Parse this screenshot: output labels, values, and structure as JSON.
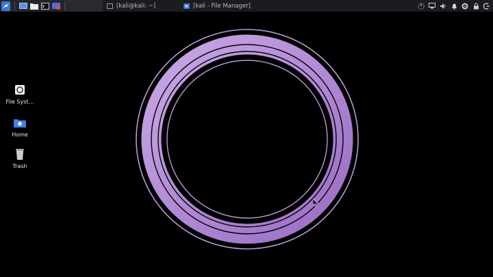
{
  "panel": {
    "tasks": [
      {
        "label": "[kali@kali: ~]",
        "icon": "terminal-icon"
      },
      {
        "label": "[kali - File Manager]",
        "icon": "file-manager-icon"
      }
    ],
    "tray_icons": [
      "clock-dial-icon",
      "screen-icon",
      "volume-icon",
      "notification-bell-icon",
      "power-settings-icon",
      "lock-icon",
      "logout-icon"
    ]
  },
  "desktop": {
    "icons": [
      {
        "label": "File Syst…",
        "icon": "drive-icon"
      },
      {
        "label": "Home",
        "icon": "home-folder-icon"
      },
      {
        "label": "Trash",
        "icon": "trash-icon"
      }
    ]
  },
  "colors": {
    "panel_bg": "#1b1c20",
    "ring_light": "#c8a8e6",
    "ring_dark": "#9a6dc4",
    "desktop_bg": "#000000"
  }
}
